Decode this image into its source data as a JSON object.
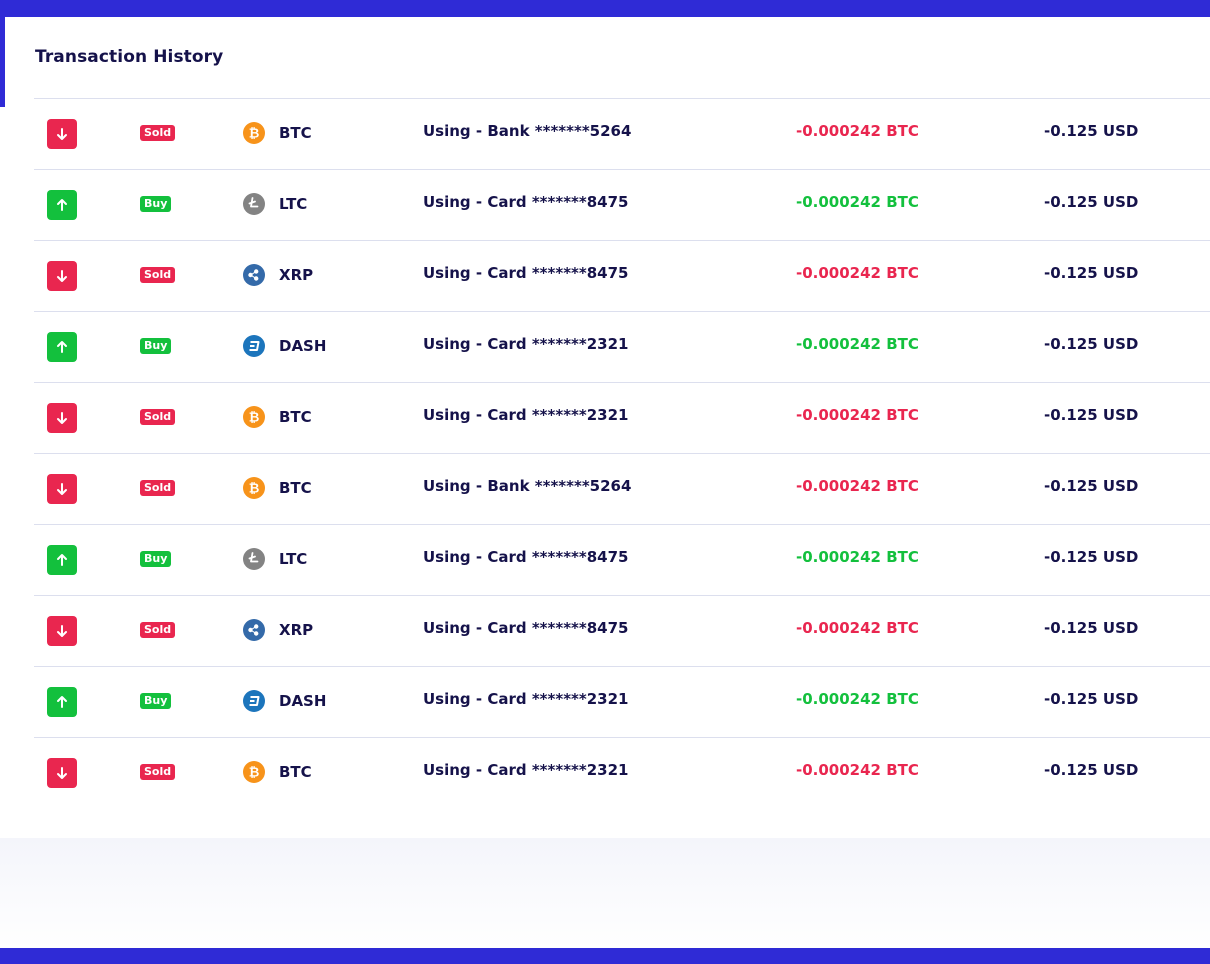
{
  "card": {
    "title": "Transaction History"
  },
  "colors": {
    "brand": "#2f2bd6",
    "sold": "#e9264f",
    "buy": "#13c03d",
    "text": "#15124a",
    "btc": "#f7931a",
    "ltc": "#838383",
    "xrp": "#346aa9",
    "dash": "#1c75bc"
  },
  "transactions": [
    {
      "direction": "down",
      "type": "Sold",
      "coin": "BTC",
      "coin_icon": "bitcoin-icon",
      "method": "Using - Bank *******5264",
      "amount": "-0.000242 BTC",
      "usd": "-0.125 USD"
    },
    {
      "direction": "up",
      "type": "Buy",
      "coin": "LTC",
      "coin_icon": "litecoin-icon",
      "method": "Using - Card *******8475",
      "amount": "-0.000242 BTC",
      "usd": "-0.125 USD"
    },
    {
      "direction": "down",
      "type": "Sold",
      "coin": "XRP",
      "coin_icon": "ripple-icon",
      "method": "Using - Card *******8475",
      "amount": "-0.000242 BTC",
      "usd": "-0.125 USD"
    },
    {
      "direction": "up",
      "type": "Buy",
      "coin": "DASH",
      "coin_icon": "dash-icon",
      "method": "Using - Card *******2321",
      "amount": "-0.000242 BTC",
      "usd": "-0.125 USD"
    },
    {
      "direction": "down",
      "type": "Sold",
      "coin": "BTC",
      "coin_icon": "bitcoin-icon",
      "method": "Using - Card *******2321",
      "amount": "-0.000242 BTC",
      "usd": "-0.125 USD"
    },
    {
      "direction": "down",
      "type": "Sold",
      "coin": "BTC",
      "coin_icon": "bitcoin-icon",
      "method": "Using - Bank *******5264",
      "amount": "-0.000242 BTC",
      "usd": "-0.125 USD"
    },
    {
      "direction": "up",
      "type": "Buy",
      "coin": "LTC",
      "coin_icon": "litecoin-icon",
      "method": "Using - Card *******8475",
      "amount": "-0.000242 BTC",
      "usd": "-0.125 USD"
    },
    {
      "direction": "down",
      "type": "Sold",
      "coin": "XRP",
      "coin_icon": "ripple-icon",
      "method": "Using - Card *******8475",
      "amount": "-0.000242 BTC",
      "usd": "-0.125 USD"
    },
    {
      "direction": "up",
      "type": "Buy",
      "coin": "DASH",
      "coin_icon": "dash-icon",
      "method": "Using - Card *******2321",
      "amount": "-0.000242 BTC",
      "usd": "-0.125 USD"
    },
    {
      "direction": "down",
      "type": "Sold",
      "coin": "BTC",
      "coin_icon": "bitcoin-icon",
      "method": "Using - Card *******2321",
      "amount": "-0.000242 BTC",
      "usd": "-0.125 USD"
    }
  ]
}
